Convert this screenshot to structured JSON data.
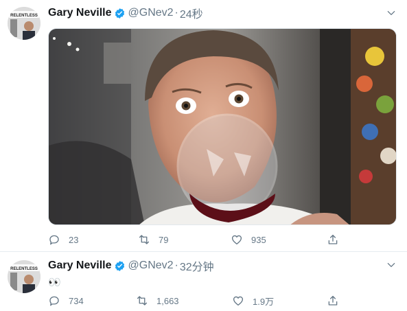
{
  "tweets": [
    {
      "name": "Gary Neville",
      "handle": "@GNev2",
      "separator": "·",
      "time": "24秒",
      "text": "",
      "avatar_caption": "RELENTLESS",
      "actions": {
        "replies": "23",
        "retweets": "79",
        "likes": "935"
      }
    },
    {
      "name": "Gary Neville",
      "handle": "@GNev2",
      "separator": "·",
      "time": "32分钟",
      "text": "👀",
      "avatar_caption": "RELENTLESS",
      "actions": {
        "replies": "734",
        "retweets": "1,663",
        "likes": "1.9万"
      }
    }
  ],
  "colors": {
    "verified": "#1da1f2",
    "meta": "#657786",
    "divider": "#e6ecf0"
  },
  "icons": [
    "reply-icon",
    "retweet-icon",
    "like-icon",
    "share-icon",
    "verified-badge-icon",
    "caret-down-icon"
  ]
}
